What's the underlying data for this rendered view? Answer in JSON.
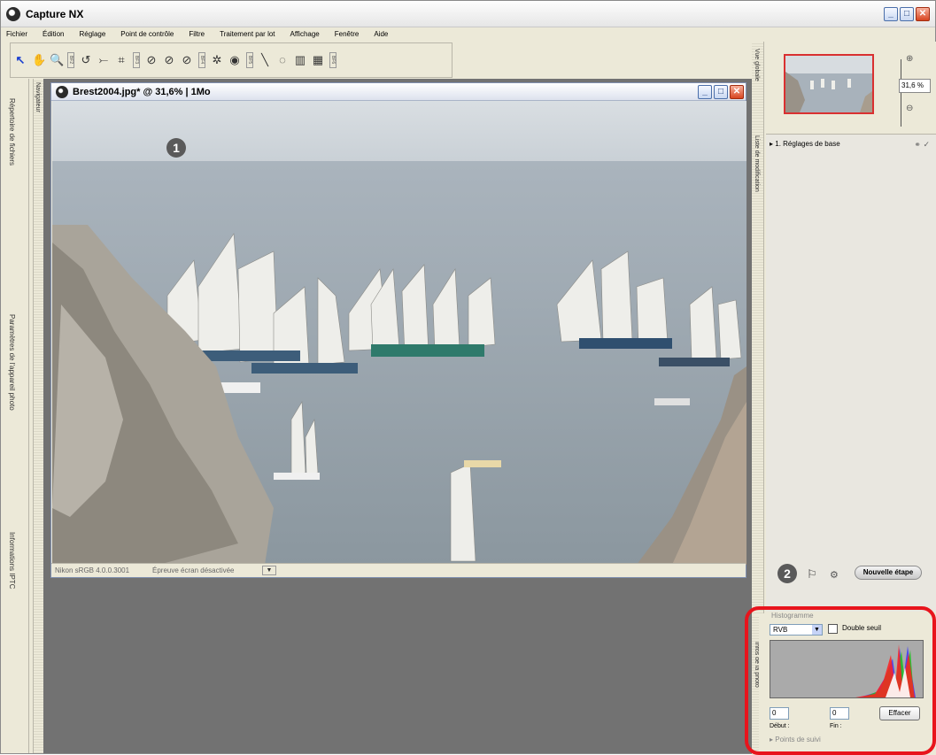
{
  "app": {
    "title": "Capture NX"
  },
  "menu": [
    "Fichier",
    "Édition",
    "Réglage",
    "Point de contrôle",
    "Filtre",
    "Traitement par lot",
    "Affichage",
    "Fenêtre",
    "Aide"
  ],
  "toolbar": {
    "groups": [
      "BF2",
      "BF3",
      "BF4",
      "BF5",
      "BF6"
    ]
  },
  "left_panel": {
    "tabs": [
      "Répertoire de fichiers",
      "Paramètres de l'appareil photo",
      "Informations IPTC"
    ],
    "navigator": "Navigateur"
  },
  "document": {
    "title": "Brest2004.jpg* @ 31,6% | 1Mo",
    "status_profile": "Nikon sRGB 4.0.0.3001",
    "status_proof": "Épreuve écran désactivée"
  },
  "badges": {
    "one": "1",
    "two": "2"
  },
  "right_panel": {
    "overview_label": "Vue globale",
    "zoom_value": "31,6",
    "zoom_unit": "%",
    "edit_list_label": "Liste de modification",
    "step": "1. Réglages de base",
    "new_step_button": "Nouvelle étape",
    "photo_info_label": "Infos de la photo"
  },
  "histogram": {
    "header": "Histogramme",
    "channel": "RVB",
    "double_seuil": "Double seuil",
    "start_value": "0",
    "end_value": "0",
    "start_label": "Début :",
    "end_label": "Fin :",
    "clear_button": "Effacer",
    "tracking": "Points de suivi"
  }
}
